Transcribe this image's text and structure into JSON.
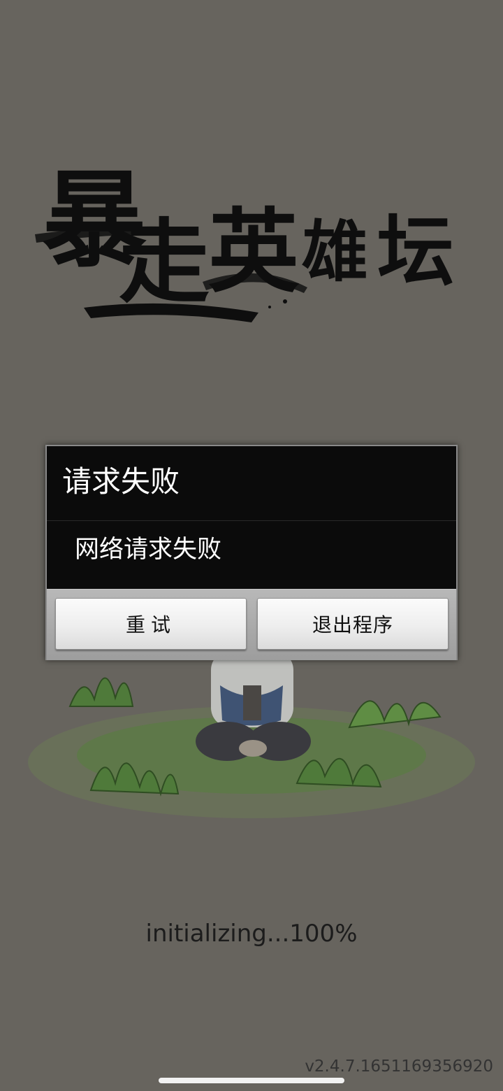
{
  "app": {
    "logo_text": [
      "暴",
      "走",
      "英",
      "雄",
      "坛"
    ]
  },
  "dialog": {
    "title": "请求失败",
    "message": "网络请求失败",
    "retry_label": "重试",
    "exit_label": "退出程序"
  },
  "status": {
    "loading_text": "initializing...100%",
    "version": "v2.4.7.1651169356920"
  },
  "colors": {
    "background": "#67645e",
    "dialog_background": "#0b0b0b",
    "button_bar": "#a8a8a8",
    "grass": "#4f7a3a"
  },
  "icons": {
    "logo": "brush-calligraphy-logo",
    "illustration": "sitting-character-with-straw-hat-on-grass"
  }
}
